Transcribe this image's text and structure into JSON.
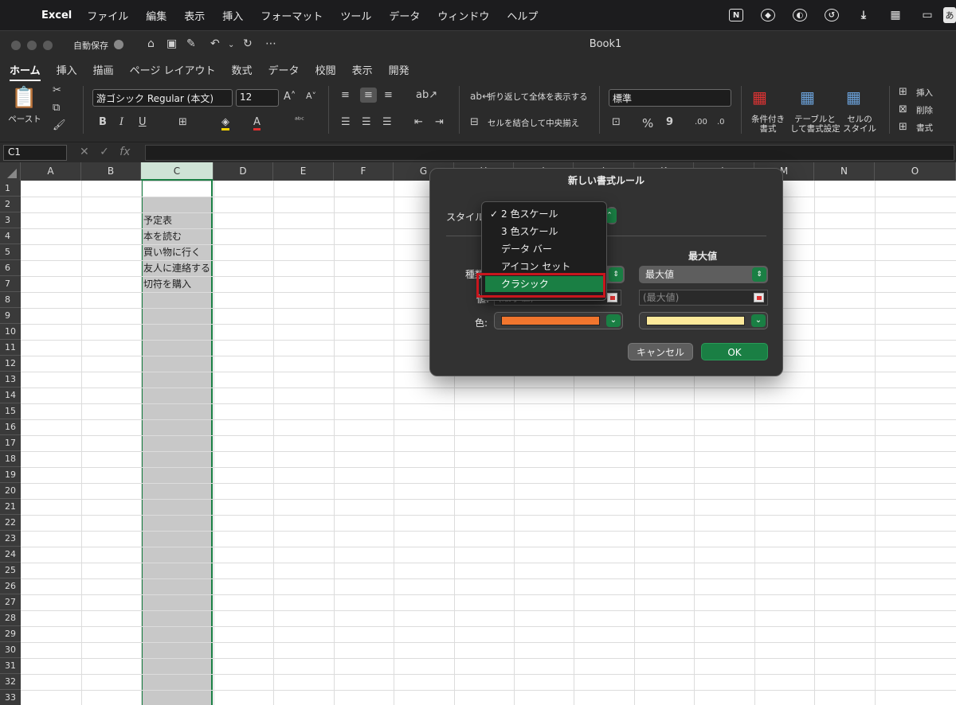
{
  "menubar": {
    "app_name": "Excel",
    "items": [
      "ファイル",
      "編集",
      "表示",
      "挿入",
      "フォーマット",
      "ツール",
      "データ",
      "ウィンドウ",
      "ヘルプ"
    ],
    "status_icons": [
      "notion-icon",
      "app-icon",
      "contrast-icon",
      "history-icon",
      "download-icon",
      "layout-icon",
      "display-icon"
    ],
    "ime": "あ"
  },
  "window": {
    "autosave_label": "自動保存",
    "title": "Book1",
    "quick_access": [
      "home-icon",
      "save-icon",
      "save-as-icon",
      "undo-icon",
      "redo-icon",
      "more-icon"
    ]
  },
  "ribbon_tabs": [
    {
      "label": "ホーム",
      "active": true
    },
    {
      "label": "挿入"
    },
    {
      "label": "描画"
    },
    {
      "label": "ページ レイアウト"
    },
    {
      "label": "数式"
    },
    {
      "label": "データ"
    },
    {
      "label": "校閲"
    },
    {
      "label": "表示"
    },
    {
      "label": "開発"
    }
  ],
  "ribbon": {
    "paste_label": "ペースト",
    "font_name": "游ゴシック Regular (本文)",
    "font_size": "12",
    "bold": "B",
    "italic": "I",
    "underline": "U",
    "wrap_text": "折り返して全体を表示する",
    "merge_center": "セルを結合して中央揃え",
    "number_format": "標準",
    "percent": "%",
    "comma": "9",
    "cond_format": "条件付き\n書式",
    "table_format": "テーブルと\nして書式設定",
    "cell_styles": "セルの\nスタイル",
    "insert": "挿入",
    "delete": "削除",
    "format": "書式"
  },
  "formula_bar": {
    "name_box": "C1",
    "fx": "fx",
    "content": ""
  },
  "sheet": {
    "columns": [
      "A",
      "B",
      "C",
      "D",
      "E",
      "F",
      "G",
      "H",
      "I",
      "J",
      "K",
      "L",
      "M",
      "N",
      "O"
    ],
    "selected_column": "C",
    "rows": [
      "1",
      "2",
      "3",
      "4",
      "5",
      "6",
      "7",
      "8",
      "9",
      "10",
      "11",
      "12",
      "13",
      "14",
      "15",
      "16",
      "17",
      "18",
      "19",
      "20",
      "21",
      "22",
      "23",
      "24",
      "25",
      "26",
      "27",
      "28",
      "29",
      "30",
      "31",
      "32",
      "33"
    ],
    "cells": [
      {
        "row": "3",
        "col": "C",
        "value": "予定表"
      },
      {
        "row": "4",
        "col": "C",
        "value": "本を読む"
      },
      {
        "row": "5",
        "col": "C",
        "value": "買い物に行く"
      },
      {
        "row": "6",
        "col": "C",
        "value": "友人に連絡する"
      },
      {
        "row": "7",
        "col": "C",
        "value": "切符を購入"
      }
    ]
  },
  "dialog": {
    "title": "新しい書式ルール",
    "style_label": "スタイル",
    "max_header": "最大値",
    "type_label": "種類:",
    "value_label": "値:",
    "color_label": "色:",
    "max_type": "最大値",
    "min_value_placeholder": "(最小値)",
    "max_value_placeholder": "(最大値)",
    "min_color": "#f2762e",
    "max_color": "#fde99a",
    "cancel": "キャンセル",
    "ok": "OK"
  },
  "style_menu": {
    "items": [
      {
        "label": "2 色スケール",
        "checked": true
      },
      {
        "label": "3 色スケール"
      },
      {
        "label": "データ バー"
      },
      {
        "label": "アイコン セット"
      },
      {
        "label": "クラシック",
        "highlighted": true
      }
    ]
  },
  "colors": {
    "accent_green": "#1a7f44",
    "highlight_red": "#c8161d"
  }
}
